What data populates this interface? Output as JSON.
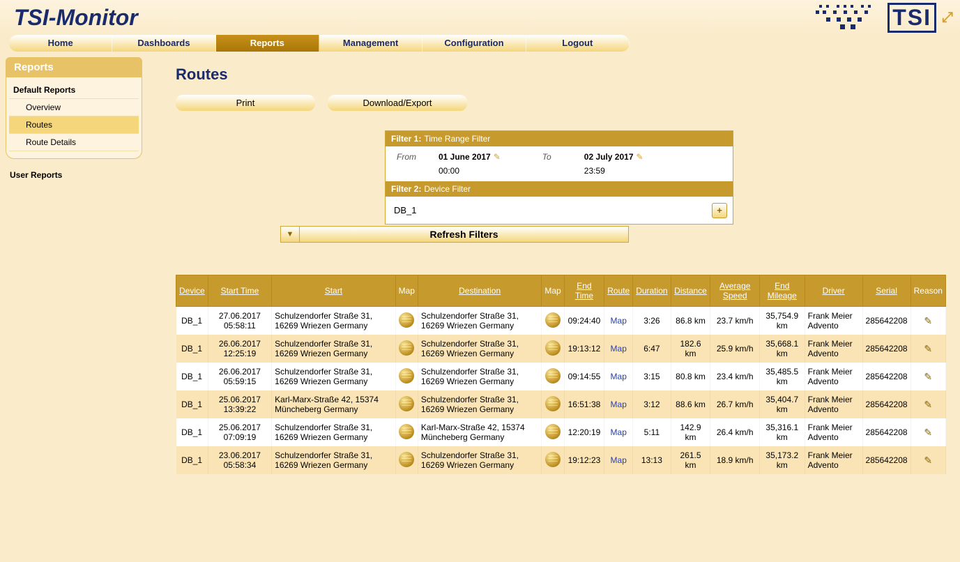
{
  "app": {
    "title": "TSI-Monitor",
    "logo_text": "TSI"
  },
  "nav": {
    "items": [
      "Home",
      "Dashboards",
      "Reports",
      "Management",
      "Configuration",
      "Logout"
    ],
    "active": 2
  },
  "sidebar": {
    "title": "Reports",
    "section_title": "Default Reports",
    "items": [
      {
        "label": "Overview",
        "active": false
      },
      {
        "label": "Routes",
        "active": true
      },
      {
        "label": "Route Details",
        "active": false
      }
    ],
    "loose": "User Reports"
  },
  "page": {
    "title": "Routes",
    "print": "Print",
    "export": "Download/Export",
    "filter1_label": "Filter 1:",
    "filter1_name": "Time Range Filter",
    "from_label": "From",
    "to_label": "To",
    "from_date": "01 June 2017",
    "from_time": "00:00",
    "to_date": "02 July 2017",
    "to_time": "23:59",
    "filter2_label": "Filter 2:",
    "filter2_name": "Device Filter",
    "device_value": "DB_1",
    "refresh": "Refresh Filters"
  },
  "table": {
    "columns": [
      "Device",
      "Start Time",
      "Start",
      "Map",
      "Destination",
      "Map",
      "End Time",
      "Route",
      "Duration",
      "Distance",
      "Average Speed",
      "End Mileage",
      "Driver",
      "Serial",
      "Reason"
    ],
    "rows": [
      {
        "device": "DB_1",
        "start_time": "27.06.2017 05:58:11",
        "start": "Schulzendorfer Straße 31, 16269 Wriezen Germany",
        "destination": "Schulzendorfer Straße 31, 16269 Wriezen Germany",
        "end_time": "09:24:40",
        "route": "Map",
        "duration": "3:26",
        "distance": "86.8 km",
        "avg_speed": "23.7 km/h",
        "end_mileage": "35,754.9 km",
        "driver": "Frank Meier Advento",
        "serial": "285642208"
      },
      {
        "device": "DB_1",
        "start_time": "26.06.2017 12:25:19",
        "start": "Schulzendorfer Straße 31, 16269 Wriezen Germany",
        "destination": "Schulzendorfer Straße 31, 16269 Wriezen Germany",
        "end_time": "19:13:12",
        "route": "Map",
        "duration": "6:47",
        "distance": "182.6 km",
        "avg_speed": "25.9 km/h",
        "end_mileage": "35,668.1 km",
        "driver": "Frank Meier Advento",
        "serial": "285642208"
      },
      {
        "device": "DB_1",
        "start_time": "26.06.2017 05:59:15",
        "start": "Schulzendorfer Straße 31, 16269 Wriezen Germany",
        "destination": "Schulzendorfer Straße 31, 16269 Wriezen Germany",
        "end_time": "09:14:55",
        "route": "Map",
        "duration": "3:15",
        "distance": "80.8 km",
        "avg_speed": "23.4 km/h",
        "end_mileage": "35,485.5 km",
        "driver": "Frank Meier Advento",
        "serial": "285642208"
      },
      {
        "device": "DB_1",
        "start_time": "25.06.2017 13:39:22",
        "start": "Karl-Marx-Straße 42, 15374 Müncheberg Germany",
        "destination": "Schulzendorfer Straße 31, 16269 Wriezen Germany",
        "end_time": "16:51:38",
        "route": "Map",
        "duration": "3:12",
        "distance": "88.6 km",
        "avg_speed": "26.7 km/h",
        "end_mileage": "35,404.7 km",
        "driver": "Frank Meier Advento",
        "serial": "285642208"
      },
      {
        "device": "DB_1",
        "start_time": "25.06.2017 07:09:19",
        "start": "Schulzendorfer Straße 31, 16269 Wriezen Germany",
        "destination": "Karl-Marx-Straße 42, 15374 Müncheberg Germany",
        "end_time": "12:20:19",
        "route": "Map",
        "duration": "5:11",
        "distance": "142.9 km",
        "avg_speed": "26.4 km/h",
        "end_mileage": "35,316.1 km",
        "driver": "Frank Meier Advento",
        "serial": "285642208"
      },
      {
        "device": "DB_1",
        "start_time": "23.06.2017 05:58:34",
        "start": "Schulzendorfer Straße 31, 16269 Wriezen Germany",
        "destination": "Schulzendorfer Straße 31, 16269 Wriezen Germany",
        "end_time": "19:12:23",
        "route": "Map",
        "duration": "13:13",
        "distance": "261.5 km",
        "avg_speed": "18.9 km/h",
        "end_mileage": "35,173.2 km",
        "driver": "Frank Meier Advento",
        "serial": "285642208"
      }
    ]
  }
}
